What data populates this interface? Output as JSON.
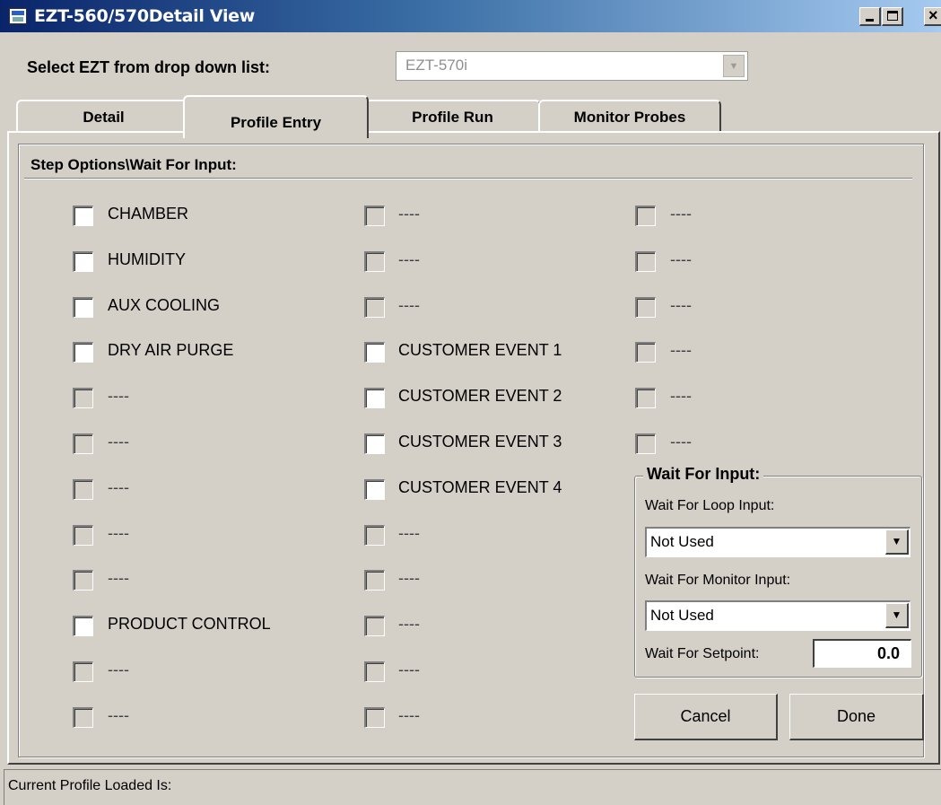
{
  "window": {
    "title": "EZT-560/570Detail View"
  },
  "selector": {
    "label": "Select EZT from drop down list:",
    "value": "EZT-570i"
  },
  "tabs": [
    {
      "label": "Detail"
    },
    {
      "label": "Profile Entry",
      "active": true
    },
    {
      "label": "Profile Run"
    },
    {
      "label": "Monitor Probes"
    }
  ],
  "group": {
    "title": "Step Options\\Wait For Input:"
  },
  "columns": [
    [
      {
        "label": "CHAMBER",
        "enabled": true
      },
      {
        "label": "HUMIDITY",
        "enabled": true
      },
      {
        "label": "AUX COOLING",
        "enabled": true
      },
      {
        "label": "DRY AIR PURGE",
        "enabled": true
      },
      {
        "label": "----",
        "enabled": false
      },
      {
        "label": "----",
        "enabled": false
      },
      {
        "label": "----",
        "enabled": false
      },
      {
        "label": "----",
        "enabled": false
      },
      {
        "label": "----",
        "enabled": false
      },
      {
        "label": "PRODUCT CONTROL",
        "enabled": true
      },
      {
        "label": "----",
        "enabled": false
      },
      {
        "label": "----",
        "enabled": false
      }
    ],
    [
      {
        "label": "----",
        "enabled": false
      },
      {
        "label": "----",
        "enabled": false
      },
      {
        "label": "----",
        "enabled": false
      },
      {
        "label": "CUSTOMER EVENT 1",
        "enabled": true
      },
      {
        "label": "CUSTOMER EVENT 2",
        "enabled": true
      },
      {
        "label": "CUSTOMER EVENT 3",
        "enabled": true
      },
      {
        "label": "CUSTOMER EVENT 4",
        "enabled": true
      },
      {
        "label": "----",
        "enabled": false
      },
      {
        "label": "----",
        "enabled": false
      },
      {
        "label": "----",
        "enabled": false
      },
      {
        "label": "----",
        "enabled": false
      },
      {
        "label": "----",
        "enabled": false
      }
    ],
    [
      {
        "label": "----",
        "enabled": false
      },
      {
        "label": "----",
        "enabled": false
      },
      {
        "label": "----",
        "enabled": false
      },
      {
        "label": "----",
        "enabled": false
      },
      {
        "label": "----",
        "enabled": false
      },
      {
        "label": "----",
        "enabled": false
      }
    ]
  ],
  "wait": {
    "title": "Wait For Input:",
    "loop_label": "Wait For Loop Input:",
    "loop_value": "Not Used",
    "monitor_label": "Wait For Monitor Input:",
    "monitor_value": "Not Used",
    "setpoint_label": "Wait For Setpoint:",
    "setpoint_value": "0.0"
  },
  "buttons": {
    "cancel": "Cancel",
    "done": "Done"
  },
  "status": {
    "text": "Current Profile Loaded Is:"
  }
}
